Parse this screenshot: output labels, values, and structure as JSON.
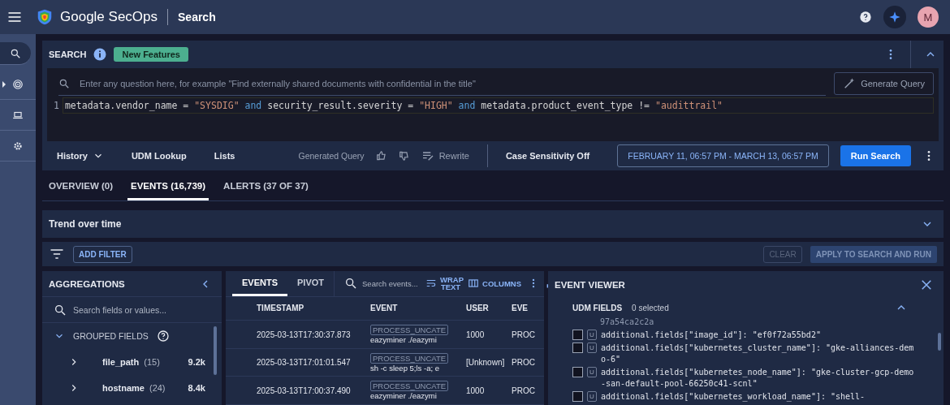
{
  "topbar": {
    "app_name": "Google SecOps",
    "page_title": "Search",
    "avatar_initial": "M"
  },
  "rail": {
    "items": [
      {
        "kind": "search",
        "selected": true
      },
      {
        "kind": "radar",
        "selected": false
      },
      {
        "kind": "laptop",
        "selected": false
      },
      {
        "kind": "gear",
        "selected": false
      }
    ]
  },
  "search": {
    "title": "SEARCH",
    "badge": "New Features",
    "ai_placeholder": "Enter any question here, for example \"Find externally shared documents with confidential in the title\"",
    "generate_button": "Generate Query",
    "query_lines": [
      {
        "number": "1",
        "tokens": [
          {
            "text": "metadata.vendor_name = ",
            "kind": "plain"
          },
          {
            "text": "\"SYSDIG\"",
            "kind": "string"
          },
          {
            "text": " and ",
            "kind": "keyword"
          },
          {
            "text": "security_result.severity = ",
            "kind": "plain"
          },
          {
            "text": "\"HIGH\"",
            "kind": "string"
          },
          {
            "text": " and ",
            "kind": "keyword"
          },
          {
            "text": "metadata.product_event_type != ",
            "kind": "plain"
          },
          {
            "text": "\"audittrail\"",
            "kind": "string"
          }
        ]
      }
    ],
    "toolbar": {
      "history": "History",
      "udm_lookup": "UDM Lookup",
      "lists": "Lists",
      "generated_query": "Generated Query",
      "rewrite": "Rewrite",
      "case_sensitivity": "Case Sensitivity Off",
      "date_range": "FEBRUARY 11, 06:57 PM - MARCH 13, 06:57 PM",
      "run": "Run Search"
    }
  },
  "tabs": [
    {
      "label": "OVERVIEW (0)",
      "selected": false
    },
    {
      "label": "EVENTS (16,739)",
      "selected": true
    },
    {
      "label": "ALERTS (37 OF 37)",
      "selected": false
    }
  ],
  "trend": {
    "title": "Trend over time"
  },
  "filter_bar": {
    "add_filter": "ADD FILTER",
    "clear": "CLEAR",
    "apply": "APPLY TO SEARCH AND RUN"
  },
  "aggregations": {
    "title": "AGGREGATIONS",
    "search_placeholder": "Search fields or values...",
    "group": {
      "label": "GROUPED FIELDS",
      "expanded": true,
      "fields": [
        {
          "name": "file_path",
          "count": "(15)",
          "total": "9.2k"
        },
        {
          "name": "hostname",
          "count": "(24)",
          "total": "8.4k"
        }
      ]
    }
  },
  "events": {
    "tabs": [
      {
        "label": "EVENTS",
        "selected": true
      },
      {
        "label": "PIVOT",
        "selected": false
      }
    ],
    "search_placeholder": "Search events...",
    "wrap_text": "WRAP TEXT",
    "columns_button": "COLUMNS",
    "table": {
      "columns": [
        "TIMESTAMP",
        "EVENT",
        "USER",
        "EVE"
      ],
      "rows": [
        {
          "timestamp": "2025-03-13T17:30:37.873",
          "event_type": "PROCESS_UNCATE",
          "event_text": "eazyminer ./eazymi",
          "user": "1000",
          "column_4": "PROC"
        },
        {
          "timestamp": "2025-03-13T17:01:01.547",
          "event_type": "PROCESS_UNCATE",
          "event_text": "sh -c sleep 5;ls -a; e",
          "user": "[Unknown]",
          "column_4": "PROC"
        },
        {
          "timestamp": "2025-03-13T17:00:37.490",
          "event_type": "PROCESS_UNCATE",
          "event_text": "eazyminer ./eazymi",
          "user": "1000",
          "column_4": "PROC"
        }
      ]
    }
  },
  "event_viewer": {
    "title": "EVENT VIEWER",
    "section": "UDM FIELDS",
    "expanded": true,
    "selected_count": "0 selected",
    "clipped_value": "97a54ca2c2a",
    "fields": [
      {
        "tag": "U",
        "key": "additional.fields[\"image_id\"]:",
        "value": "\"ef0f72a55bd2\"",
        "checked": false
      },
      {
        "tag": "U",
        "key": "additional.fields[\"kubernetes_cluster_name\"]:",
        "value": "\"gke-alliances-demo-6\"",
        "checked": false
      },
      {
        "tag": "U",
        "key": "additional.fields[\"kubernetes_node_name\"]:",
        "value": "\"gke-cluster-gcp-demo-san-default-pool-66250c41-scnl\"",
        "checked": false
      },
      {
        "tag": "U",
        "key": "additional.fields[\"kubernetes_workload_name\"]:",
        "value": "\"shell-",
        "checked": false
      }
    ]
  }
}
